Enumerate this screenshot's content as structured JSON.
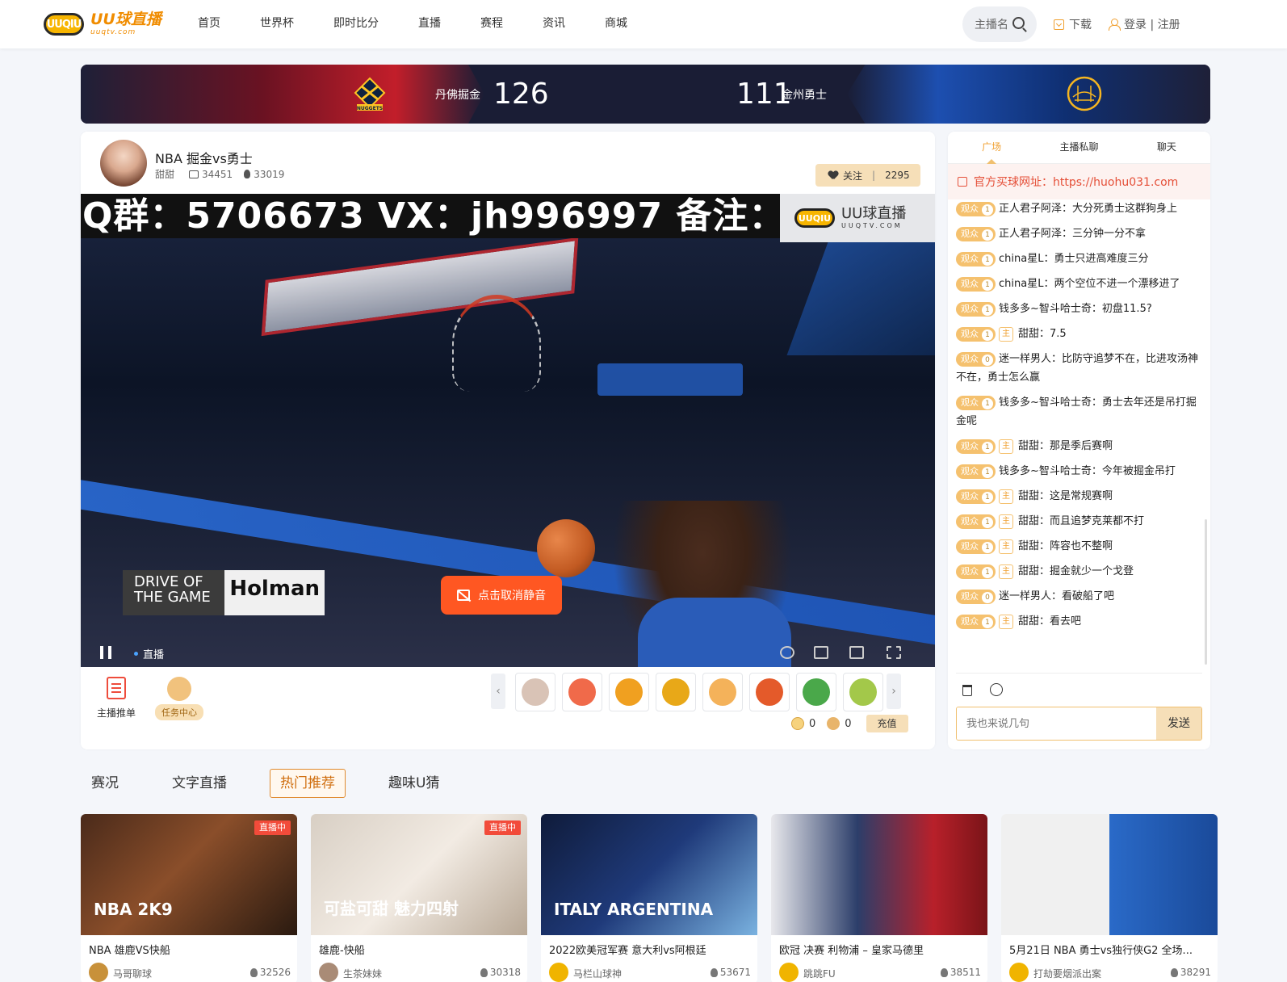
{
  "brand": {
    "logo_badge": "UUQIU",
    "name": "UU球直播",
    "domain": "uuqtv.com"
  },
  "nav": {
    "items": [
      {
        "label": "首页"
      },
      {
        "label": "世界杯"
      },
      {
        "label": "即时比分"
      },
      {
        "label": "直播"
      },
      {
        "label": "赛程"
      },
      {
        "label": "资讯"
      },
      {
        "label": "商城"
      }
    ],
    "search_placeholder": "主播名",
    "download_label": "下载",
    "login_label": "登录 | 注册"
  },
  "scoreboard": {
    "home_team": "丹佛掘金",
    "home_score": "126",
    "away_team": "金州勇士",
    "away_score": "111",
    "home_logo_text": "NUGGETS"
  },
  "stream": {
    "title": "NBA 掘金vs勇士",
    "anchor": "甜甜",
    "room_id": "34451",
    "heat": "33019",
    "follow_label": "关注",
    "follow_count": "2295",
    "video_banner": "Q群：5706673   VX：jh996997  备注：甜甜",
    "video_logo_name": "UU球直播",
    "video_logo_domain": "UUQTV.COM",
    "ad_left": "DRIVE OF THE GAME",
    "ad_right": "Holman",
    "unmute_label": "点击取消静音",
    "live_label": "直播"
  },
  "tools": {
    "anchor_list": "主播推单",
    "task_center": "任务中心",
    "u_coins": "0",
    "beans": "0",
    "recharge": "充值"
  },
  "gifts": [
    {
      "icon": "girl-avatar-icon",
      "color": "#d9c3b6"
    },
    {
      "icon": "rocket-icon",
      "color": "#f06a4a"
    },
    {
      "icon": "gift-text-icon",
      "color": "#f0a020"
    },
    {
      "icon": "badge-text-icon",
      "color": "#e8a818"
    },
    {
      "icon": "smile-face-icon",
      "color": "#f4b25a"
    },
    {
      "icon": "gift-text2-icon",
      "color": "#e45a2a"
    },
    {
      "icon": "field-icon",
      "color": "#4aa84a"
    },
    {
      "icon": "cup-icon",
      "color": "#a3c84a"
    }
  ],
  "chat": {
    "tabs": [
      "广场",
      "主播私聊",
      "聊天"
    ],
    "notice": "官方买球网址：https://huohu031.com",
    "messages": [
      {
        "level": "1",
        "host": false,
        "text": "正人君子阿泽：大分死勇士这群狗身上"
      },
      {
        "level": "1",
        "host": false,
        "text": "正人君子阿泽：三分钟一分不拿"
      },
      {
        "level": "1",
        "host": false,
        "text": "china星L：勇士只进高难度三分"
      },
      {
        "level": "1",
        "host": false,
        "text": "china星L：两个空位不进一个漂移进了"
      },
      {
        "level": "1",
        "host": false,
        "text": "钱多多~智斗哈士奇：初盘11.5?"
      },
      {
        "level": "1",
        "host": true,
        "text": "甜甜：7.5"
      },
      {
        "level": "0",
        "host": false,
        "text": "迷一样男人：比防守追梦不在，比进攻汤神不在，勇士怎么赢"
      },
      {
        "level": "1",
        "host": false,
        "text": "钱多多~智斗哈士奇：勇士去年还是吊打掘金呢"
      },
      {
        "level": "1",
        "host": true,
        "text": "甜甜：那是季后赛啊"
      },
      {
        "level": "1",
        "host": false,
        "text": "钱多多~智斗哈士奇：今年被掘金吊打"
      },
      {
        "level": "1",
        "host": true,
        "text": "甜甜：这是常规赛啊"
      },
      {
        "level": "1",
        "host": true,
        "text": "甜甜：而且追梦克莱都不打"
      },
      {
        "level": "1",
        "host": true,
        "text": "甜甜：阵容也不整啊"
      },
      {
        "level": "1",
        "host": true,
        "text": "甜甜：掘金就少一个戈登"
      },
      {
        "level": "0",
        "host": false,
        "text": "迷一样男人：看破船了吧"
      },
      {
        "level": "1",
        "host": true,
        "text": "甜甜：看去吧"
      }
    ],
    "viewer_tag": "观众",
    "host_tag": "主",
    "input_placeholder": "我也来说几句",
    "send_label": "发送"
  },
  "bottom_tabs": [
    {
      "label": "赛况",
      "active": false
    },
    {
      "label": "文字直播",
      "active": false
    },
    {
      "label": "热门推荐",
      "active": true
    },
    {
      "label": "趣味U猜",
      "active": false
    }
  ],
  "cards": [
    {
      "title": "NBA 雄鹿VS快船",
      "anchor": "马哥聊球",
      "heat": "32526",
      "live": true,
      "live_label": "直播中",
      "caption": "NBA 2K9",
      "bg": "linear-gradient(135deg,#4a2a1a 0%,#8a4e2a 45%,#2a1a10 100%)",
      "avatar": "#c8913a"
    },
    {
      "title": "雄鹿-快船",
      "anchor": "生茶妹妹",
      "heat": "30318",
      "live": true,
      "live_label": "直播中",
      "caption": "可盐可甜 魅力四射",
      "bg": "linear-gradient(135deg,#d8cfc4 0%,#f2ebe3 50%,#b8a896 100%)",
      "avatar": "#a98b76"
    },
    {
      "title": "2022欧美冠军赛 意大利vs阿根廷",
      "anchor": "马栏山球神",
      "heat": "53671",
      "live": false,
      "live_label": "",
      "caption": "ITALY ARGENTINA",
      "bg": "linear-gradient(135deg,#0f1b3a 0%,#1f3a7a 50%,#7ab2e0 100%)",
      "avatar": "#f0b400"
    },
    {
      "title": "欧冠 决赛 利物浦 – 皇家马德里",
      "anchor": "跳跳FU",
      "heat": "38511",
      "live": false,
      "live_label": "",
      "caption": "",
      "bg": "linear-gradient(90deg,#e8e8ec 0%,#2c3e6a 40%,#b8202a 75%,#7a1418 100%)",
      "avatar": "#f0b400"
    },
    {
      "title": "5月21日 NBA 勇士vs独行侠G2 全场...",
      "anchor": "打劫要烟派出案",
      "heat": "38291",
      "live": false,
      "live_label": "",
      "caption": "",
      "bg": "linear-gradient(90deg,#f0f0f0 0%,#f0f0f0 50%,#2a6ac8 50%,#1a4a9a 100%)",
      "avatar": "#f0b400"
    }
  ]
}
